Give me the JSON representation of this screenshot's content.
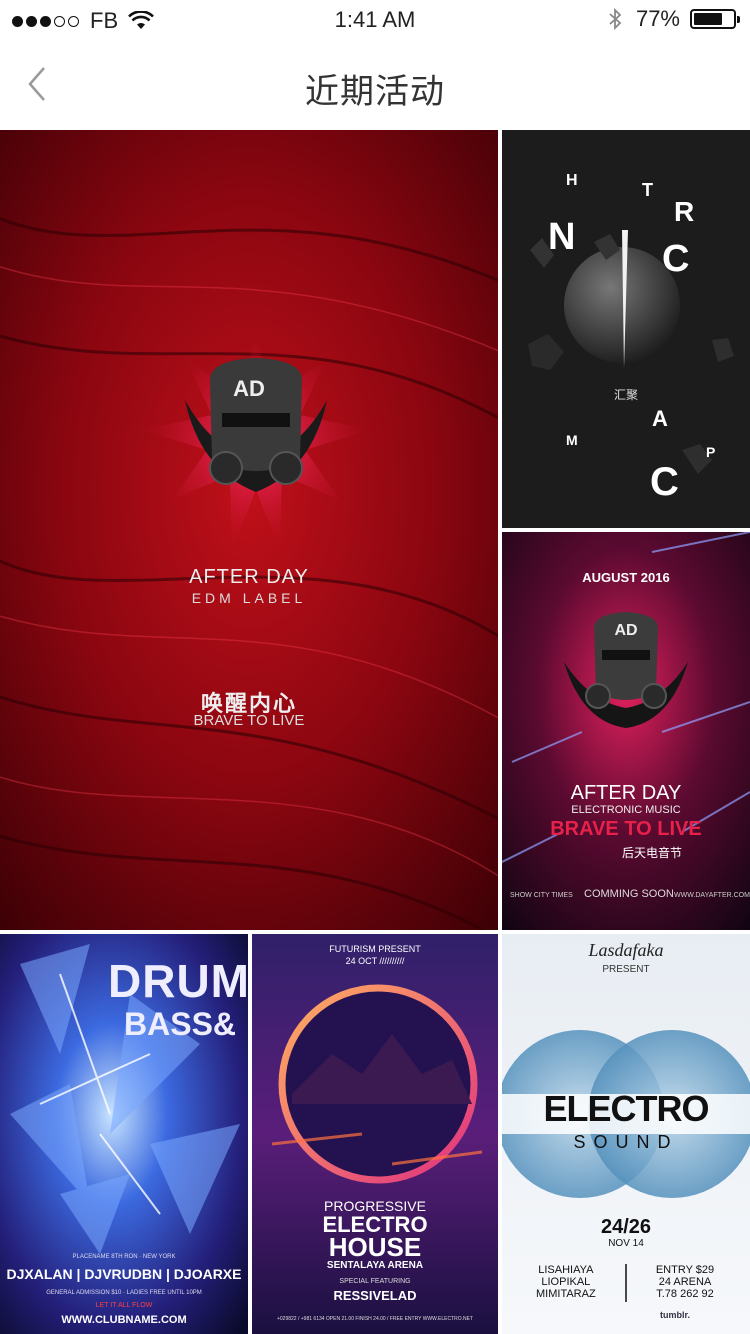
{
  "status_bar": {
    "carrier": "FB",
    "time": "1:41 AM",
    "battery": "77%",
    "battery_level": 0.77
  },
  "nav": {
    "title": "近期活动",
    "back_icon": "chevron-left-icon"
  },
  "posters": {
    "afterday_main": {
      "logo": "AD",
      "title_line1": "AFTER DAY",
      "title_line2": "EDM LABEL",
      "slogan_cn": "唤醒内心",
      "slogan_en": "BRAVE TO LIVE"
    },
    "space": {
      "letters": [
        "H",
        "T",
        "R",
        "N",
        "C",
        "M",
        "A",
        "P",
        "C"
      ],
      "caption": "汇聚"
    },
    "afterday_august": {
      "date": "AUGUST 2016",
      "logo": "AD",
      "title": "AFTER DAY",
      "subtitle": "ELECTRONIC MUSIC",
      "slogan": "BRAVE TO LIVE",
      "festival_cn": "后天电音节",
      "footer_left": "SHOW CITY TIMES",
      "footer_center": "COMMING SOON",
      "footer_right": "WWW.DAYAFTER.COM"
    },
    "drum_bass": {
      "title_line1": "DRUM",
      "title_line2": "BASS&",
      "venue": "PLACENAME 8TH RON · NEW YORK",
      "djs": "DJXALAN | DJVRUDBN | DJOARXE",
      "admission": "GENERAL ADMISSION $10 · LADIES FREE UNTIL 10PM",
      "tagline": "LET IT ALL FLOW",
      "website": "WWW.CLUBNAME.COM"
    },
    "electro_house": {
      "presenter": "FUTURISM PRESENT",
      "date": "24 OCT //////////",
      "line1": "PROGRESSIVE",
      "line2": "ELECTRO",
      "line3": "HOUSE",
      "venue": "SENTALAYA ARENA",
      "featuring_label": "SPECIAL FEATURING",
      "featuring": "RESSIVELAD",
      "footer": "+029822 / +981 6134   OPEN 21.00 FINISH 24.00 / FREE ENTRY   WWW.ELECTRO.NET"
    },
    "electro_sound": {
      "brand": "Lasdafaka",
      "present": "PRESENT",
      "title1": "ELECTRO",
      "title2": "SOUND",
      "date": "24/26",
      "month": "NOV 14",
      "djs": [
        "LISAHIAYA",
        "LIOPIKAL",
        "MIMITARAZ"
      ],
      "entry": "ENTRY $29",
      "venue": "24 ARENA",
      "phone": "T.78 262 92",
      "social": "tumblr."
    }
  }
}
